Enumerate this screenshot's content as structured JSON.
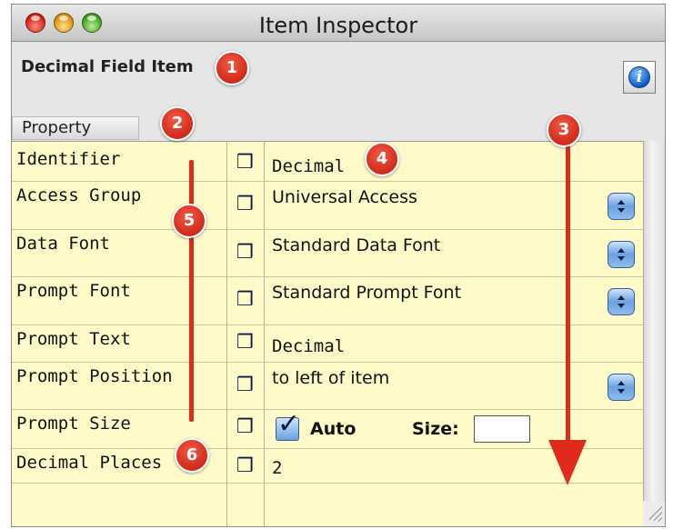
{
  "window": {
    "title": "Item Inspector",
    "item_title": "Decimal Field Item",
    "info_icon_glyph": "i",
    "column_header": "Property",
    "controls": [
      "close-button",
      "minimize-button",
      "zoom-button"
    ]
  },
  "rows": [
    {
      "label": "Identifier",
      "value": "Decimal",
      "control": "text"
    },
    {
      "label": "Access Group",
      "value": "Universal Access",
      "control": "popup"
    },
    {
      "label": "Data Font",
      "value": "Standard Data Font",
      "control": "popup"
    },
    {
      "label": "Prompt Font",
      "value": "Standard Prompt Font",
      "control": "popup"
    },
    {
      "label": "Prompt Text",
      "value": "Decimal",
      "control": "text"
    },
    {
      "label": "Prompt Position",
      "value": "to left of item",
      "control": "popup"
    },
    {
      "label": "Prompt Size",
      "checkbox_label": "Auto",
      "checked": true,
      "size_label": "Size:",
      "size_value": "",
      "control": "checkbox"
    },
    {
      "label": "Decimal Places",
      "value": "2",
      "control": "text"
    }
  ],
  "annotations": {
    "badges": [
      "1",
      "2",
      "3",
      "4",
      "5",
      "6"
    ],
    "color": "#e02a1c"
  },
  "colors": {
    "table_background": "#fffbc9",
    "window_background": "#e6e6e6",
    "badge_red": "#d83020"
  }
}
